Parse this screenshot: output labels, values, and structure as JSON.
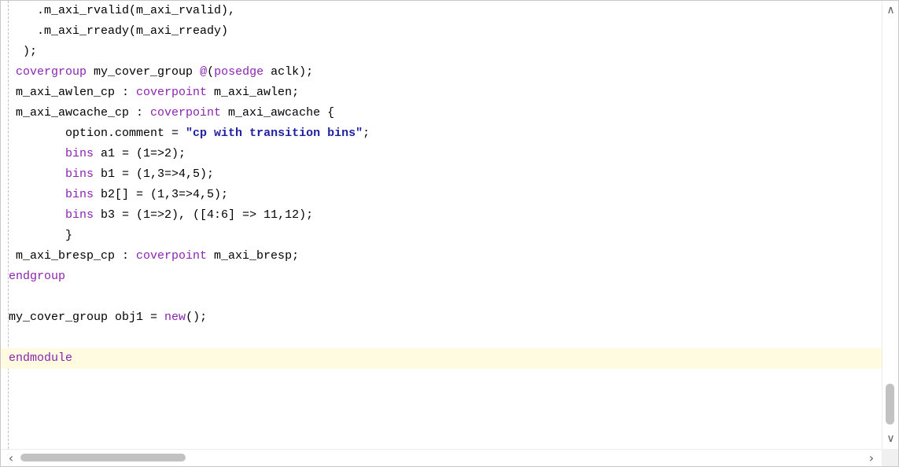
{
  "editor": {
    "lines": [
      [
        {
          "t": "    .m_axi_rvalid(m_axi_rvalid),",
          "k": "n"
        }
      ],
      [
        {
          "t": "    .m_axi_rready(m_axi_rready)",
          "k": "n"
        }
      ],
      [
        {
          "t": "  );",
          "k": "n"
        }
      ],
      [
        {
          "t": " covergroup",
          "k": "kw"
        },
        {
          "t": " my_cover_group ",
          "k": "n"
        },
        {
          "t": "@",
          "k": "kw"
        },
        {
          "t": "(",
          "k": "n"
        },
        {
          "t": "posedge",
          "k": "kw"
        },
        {
          "t": " aclk);",
          "k": "n"
        }
      ],
      [
        {
          "t": " m_axi_awlen_cp : ",
          "k": "n"
        },
        {
          "t": "coverpoint",
          "k": "kw"
        },
        {
          "t": " m_axi_awlen;",
          "k": "n"
        }
      ],
      [
        {
          "t": " m_axi_awcache_cp : ",
          "k": "n"
        },
        {
          "t": "coverpoint",
          "k": "kw"
        },
        {
          "t": " m_axi_awcache {",
          "k": "n"
        }
      ],
      [
        {
          "t": "        option.comment = ",
          "k": "n"
        },
        {
          "t": "\"cp with transition bins\"",
          "k": "str"
        },
        {
          "t": ";",
          "k": "n"
        }
      ],
      [
        {
          "t": "        ",
          "k": "n"
        },
        {
          "t": "bins",
          "k": "kw"
        },
        {
          "t": " a1 = (1=>2);",
          "k": "n"
        }
      ],
      [
        {
          "t": "        ",
          "k": "n"
        },
        {
          "t": "bins",
          "k": "kw"
        },
        {
          "t": " b1 = (1,3=>4,5);",
          "k": "n"
        }
      ],
      [
        {
          "t": "        ",
          "k": "n"
        },
        {
          "t": "bins",
          "k": "kw"
        },
        {
          "t": " b2[] = (1,3=>4,5);",
          "k": "n"
        }
      ],
      [
        {
          "t": "        ",
          "k": "n"
        },
        {
          "t": "bins",
          "k": "kw"
        },
        {
          "t": " b3 = (1=>2), ([4:6] => 11,12);",
          "k": "n"
        }
      ],
      [
        {
          "t": "        }",
          "k": "n"
        }
      ],
      [
        {
          "t": " m_axi_bresp_cp : ",
          "k": "n"
        },
        {
          "t": "coverpoint",
          "k": "kw"
        },
        {
          "t": " m_axi_bresp;",
          "k": "n"
        }
      ],
      [
        {
          "t": "endgroup",
          "k": "kw"
        }
      ],
      [],
      [
        {
          "t": "my_cover_group obj1 = ",
          "k": "n"
        },
        {
          "t": "new",
          "k": "kw"
        },
        {
          "t": "();",
          "k": "n"
        }
      ],
      [],
      [
        {
          "t": "endmodule",
          "k": "kw"
        }
      ]
    ],
    "current_line": 17
  },
  "colors": {
    "keyword": "#8a24b0",
    "string": "#1f1fa0",
    "text": "#000000",
    "current_line_bg": "#fffbe0"
  },
  "scrollbars": {
    "up_arrow_icon": "chevron-up-icon",
    "down_arrow_icon": "chevron-down-icon",
    "left_arrow_icon": "chevron-left-icon",
    "right_arrow_icon": "chevron-right-icon"
  }
}
